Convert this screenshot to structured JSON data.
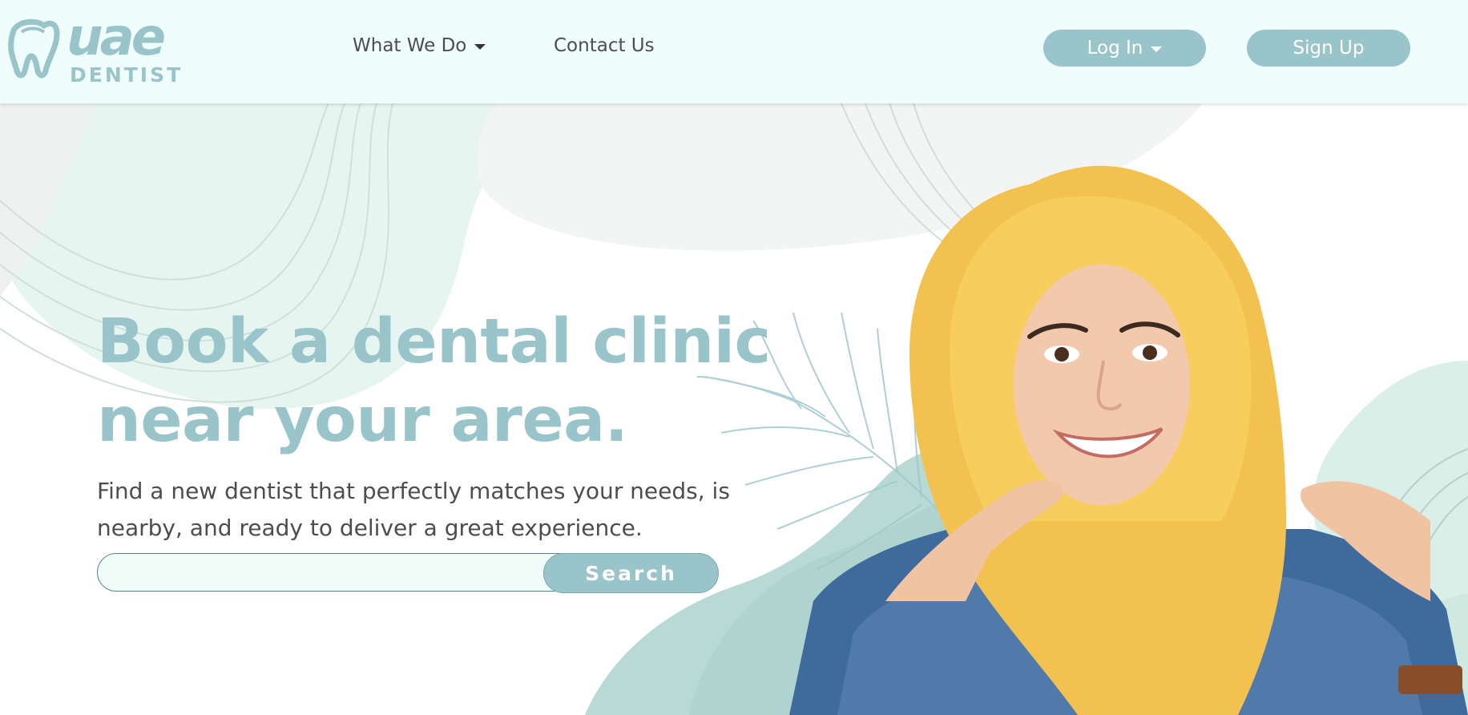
{
  "brand": {
    "logo_text_top": "uae",
    "logo_text_bottom": "DENTIST",
    "accent_color": "#99c4ca",
    "text_color": "#4d4d4d"
  },
  "nav": {
    "what_we_do": "What We Do",
    "contact_us": "Contact Us",
    "log_in": "Log In",
    "sign_up": "Sign Up"
  },
  "hero": {
    "title_line1": "Book a dental clinic",
    "title_line2": "near your area.",
    "subtitle": "Find a new dentist that perfectly matches your needs, is nearby, and ready to deliver a great experience.",
    "search_value": "",
    "search_button": "Search",
    "photo_icon": "smiling-woman-in-yellow-hijab-photo"
  }
}
